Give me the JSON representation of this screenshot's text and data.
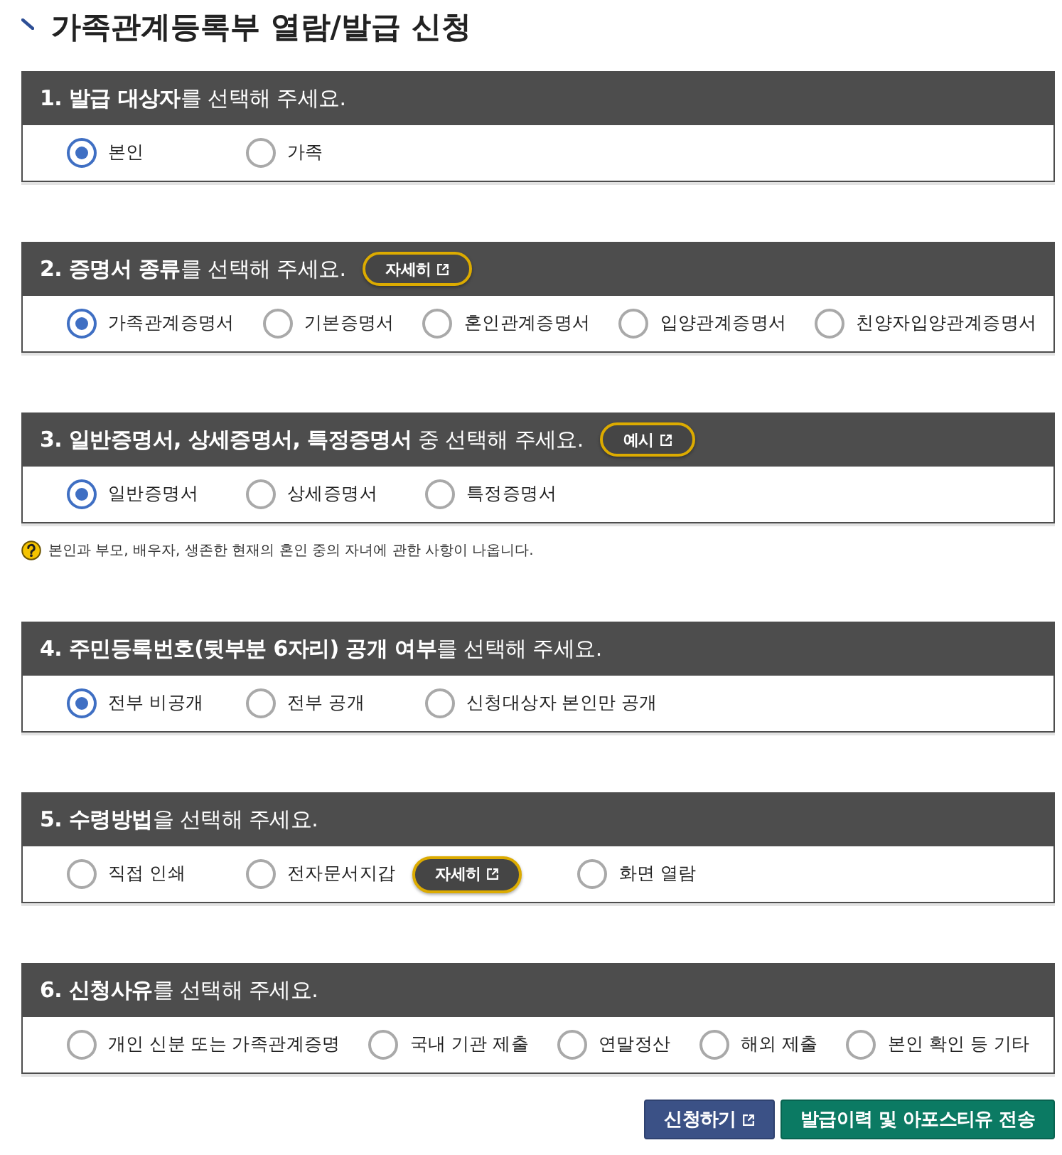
{
  "page": {
    "title": "가족관계등록부 열람/발급 신청"
  },
  "sections": [
    {
      "heading": "**1. 발급 대상자**를 선택해 주세요.",
      "options": [
        {
          "label": "본인",
          "selected": true
        },
        {
          "label": "가족",
          "selected": false
        }
      ]
    },
    {
      "heading": "**2. 증명서 종류**를 선택해 주세요.",
      "header_button": {
        "label": "자세히",
        "external": true
      },
      "options": [
        {
          "label": "가족관계증명서",
          "selected": true
        },
        {
          "label": "기본증명서",
          "selected": false
        },
        {
          "label": "혼인관계증명서",
          "selected": false
        },
        {
          "label": "입양관계증명서",
          "selected": false
        },
        {
          "label": "친양자입양관계증명서",
          "selected": false
        }
      ]
    },
    {
      "heading": "**3. 일반증명서, 상세증명서, 특정증명서** 중 선택해 주세요.",
      "header_button": {
        "label": "예시",
        "external": true
      },
      "options": [
        {
          "label": "일반증명서",
          "selected": true
        },
        {
          "label": "상세증명서",
          "selected": false
        },
        {
          "label": "특정증명서",
          "selected": false
        }
      ],
      "note": "본인과 부모, 배우자, 생존한 현재의 혼인 중의 자녀에 관한 사항이 나옵니다."
    },
    {
      "heading": "**4. 주민등록번호(뒷부분 6자리) 공개 여부**를 선택해 주세요.",
      "options": [
        {
          "label": "전부 비공개",
          "selected": true
        },
        {
          "label": "전부 공개",
          "selected": false
        },
        {
          "label": "신청대상자 본인만 공개",
          "selected": false
        }
      ]
    },
    {
      "heading": "**5. 수령방법**을 선택해 주세요.",
      "options": [
        {
          "label": "직접 인쇄",
          "selected": false
        },
        {
          "label": "전자문서지갑",
          "selected": false,
          "button": {
            "label": "자세히",
            "external": true
          }
        },
        {
          "label": "화면 열람",
          "selected": false
        }
      ]
    },
    {
      "heading": "**6. 신청사유**를 선택해 주세요.",
      "options": [
        {
          "label": "개인 신분 또는 가족관계증명",
          "selected": false
        },
        {
          "label": "국내 기관 제출",
          "selected": false
        },
        {
          "label": "연말정산",
          "selected": false
        },
        {
          "label": "해외 제출",
          "selected": false
        },
        {
          "label": "본인 확인 등 기타",
          "selected": false
        }
      ]
    }
  ],
  "actions": [
    {
      "label": "신청하기",
      "kind": "primary",
      "external": true
    },
    {
      "label": "발급이력 및 아포스티유 전송",
      "kind": "secondary",
      "external": false
    }
  ]
}
